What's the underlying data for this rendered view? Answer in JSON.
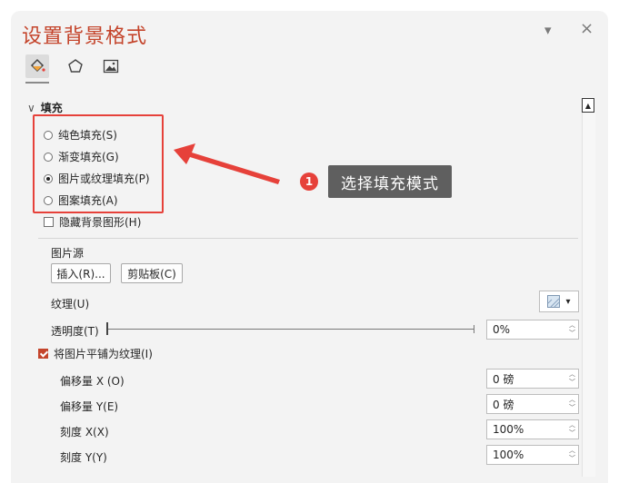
{
  "panel": {
    "title": "设置背景格式",
    "dropdown_glyph": "▾",
    "close_glyph": "×"
  },
  "tabs": [
    {
      "icon": "paint-bucket-icon",
      "active": true
    },
    {
      "icon": "pentagon-icon",
      "active": false
    },
    {
      "icon": "picture-icon",
      "active": false
    }
  ],
  "fill": {
    "section_label": "填充",
    "chevron": "∨",
    "options": [
      {
        "label": "纯色填充(S)",
        "selected": false
      },
      {
        "label": "渐变填充(G)",
        "selected": false
      },
      {
        "label": "图片或纹理填充(P)",
        "selected": true
      },
      {
        "label": "图案填充(A)",
        "selected": false
      }
    ],
    "hide_background_graphics": {
      "label": "隐藏背景图形(H)",
      "checked": false
    }
  },
  "picture_source": {
    "label": "图片源",
    "insert_button": "插入(R)...",
    "clipboard_button": "剪贴板(C)"
  },
  "texture": {
    "label": "纹理(U)",
    "dropdown_glyph": "▾"
  },
  "transparency": {
    "label": "透明度(T)",
    "value": "0%",
    "fraction": 0
  },
  "tile": {
    "label": "将图片平铺为纹理(I)",
    "checked": true
  },
  "fields": [
    {
      "label": "偏移量 X (O)",
      "value": "0 磅"
    },
    {
      "label": "偏移量 Y(E)",
      "value": "0 磅"
    },
    {
      "label": "刻度 X(X)",
      "value": "100%"
    },
    {
      "label": "刻度 Y(Y)",
      "value": "100%"
    }
  ],
  "annotation": {
    "badge": "1",
    "text": "选择填充模式",
    "color": "#e6413a"
  },
  "colors": {
    "accent": "#c4442b",
    "panel_bg": "#f3f3f3"
  }
}
